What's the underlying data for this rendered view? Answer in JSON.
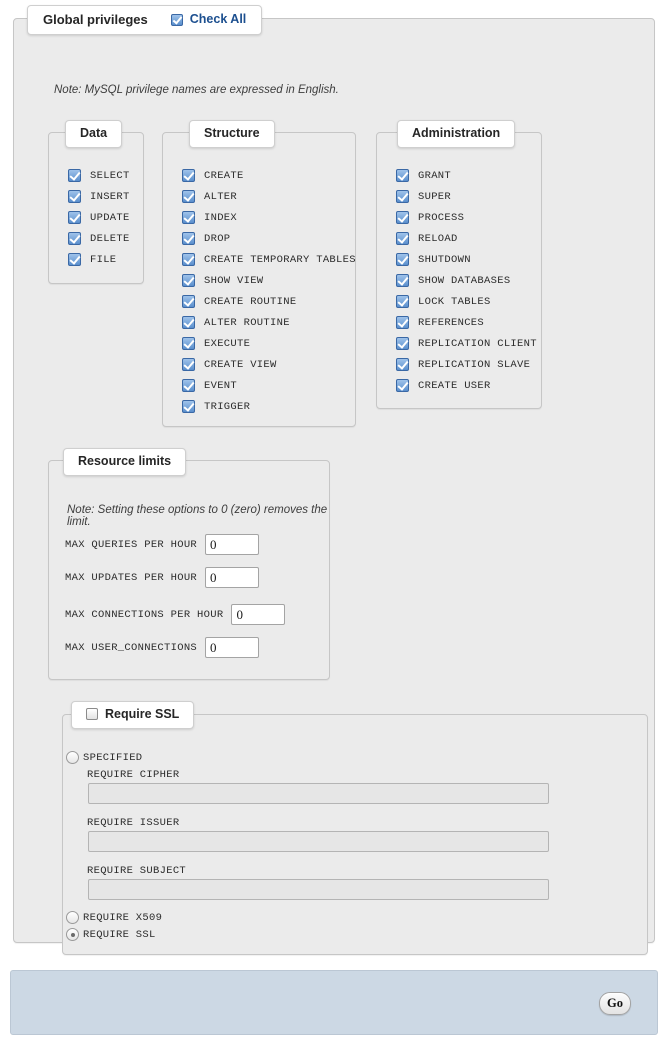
{
  "global": {
    "legend_title": "Global privileges",
    "check_all_label": "Check All",
    "check_all_checked": true,
    "note": "Note: MySQL privilege names are expressed in English."
  },
  "data_section": {
    "legend": "Data",
    "items": [
      {
        "label": "SELECT",
        "checked": true
      },
      {
        "label": "INSERT",
        "checked": true
      },
      {
        "label": "UPDATE",
        "checked": true
      },
      {
        "label": "DELETE",
        "checked": true
      },
      {
        "label": "FILE",
        "checked": true
      }
    ]
  },
  "structure_section": {
    "legend": "Structure",
    "items": [
      {
        "label": "CREATE",
        "checked": true
      },
      {
        "label": "ALTER",
        "checked": true
      },
      {
        "label": "INDEX",
        "checked": true
      },
      {
        "label": "DROP",
        "checked": true
      },
      {
        "label": "CREATE TEMPORARY TABLES",
        "checked": true
      },
      {
        "label": "SHOW VIEW",
        "checked": true
      },
      {
        "label": "CREATE ROUTINE",
        "checked": true
      },
      {
        "label": "ALTER ROUTINE",
        "checked": true
      },
      {
        "label": "EXECUTE",
        "checked": true
      },
      {
        "label": "CREATE VIEW",
        "checked": true
      },
      {
        "label": "EVENT",
        "checked": true
      },
      {
        "label": "TRIGGER",
        "checked": true
      }
    ]
  },
  "administration_section": {
    "legend": "Administration",
    "items": [
      {
        "label": "GRANT",
        "checked": true
      },
      {
        "label": "SUPER",
        "checked": true
      },
      {
        "label": "PROCESS",
        "checked": true
      },
      {
        "label": "RELOAD",
        "checked": true
      },
      {
        "label": "SHUTDOWN",
        "checked": true
      },
      {
        "label": "SHOW DATABASES",
        "checked": true
      },
      {
        "label": "LOCK TABLES",
        "checked": true
      },
      {
        "label": "REFERENCES",
        "checked": true
      },
      {
        "label": "REPLICATION CLIENT",
        "checked": true
      },
      {
        "label": "REPLICATION SLAVE",
        "checked": true
      },
      {
        "label": "CREATE USER",
        "checked": true
      }
    ]
  },
  "resource_limits": {
    "legend": "Resource limits",
    "note": "Note: Setting these options to 0 (zero) removes the limit.",
    "fields": [
      {
        "label": "MAX QUERIES PER HOUR",
        "value": "0"
      },
      {
        "label": "MAX UPDATES PER HOUR",
        "value": "0"
      },
      {
        "label": "MAX CONNECTIONS PER HOUR",
        "value": "0"
      },
      {
        "label": "MAX USER_CONNECTIONS",
        "value": "0"
      }
    ]
  },
  "ssl_section": {
    "legend": "Require SSL",
    "legend_checked": false,
    "specified_label": "SPECIFIED",
    "specified_checked": false,
    "fields": [
      {
        "label": "REQUIRE CIPHER",
        "value": ""
      },
      {
        "label": "REQUIRE ISSUER",
        "value": ""
      },
      {
        "label": "REQUIRE SUBJECT",
        "value": ""
      }
    ],
    "options": [
      {
        "label": "REQUIRE X509",
        "checked": false
      },
      {
        "label": "REQUIRE SSL",
        "checked": true
      }
    ]
  },
  "footer": {
    "go_label": "Go"
  },
  "colors": {
    "link": "#1c4f8f",
    "fieldset_bg": "#ebebeb",
    "footer_bg": "#ccd8e4",
    "checkbox_accent": "#5a8fcd"
  }
}
